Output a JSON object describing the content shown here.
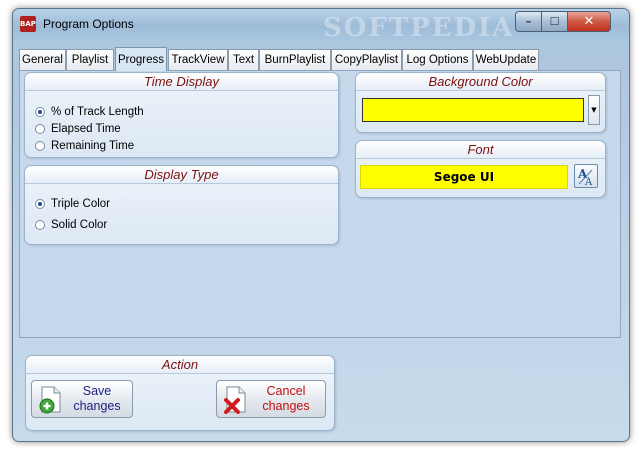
{
  "window": {
    "title": "Program Options",
    "watermark": "SOFTPEDIA",
    "icon_label": "BAP",
    "controls": {
      "minimize": "–",
      "maximize": "☐",
      "close": "✕"
    }
  },
  "tabs": [
    {
      "label": "General"
    },
    {
      "label": "Playlist"
    },
    {
      "label": "Progress"
    },
    {
      "label": "TrackView"
    },
    {
      "label": "Text"
    },
    {
      "label": "BurnPlaylist"
    },
    {
      "label": "CopyPlaylist"
    },
    {
      "label": "Log Options"
    },
    {
      "label": "WebUpdate"
    }
  ],
  "active_tab": "Progress",
  "time_display": {
    "title": "Time Display",
    "options": [
      {
        "label": "% of Track Length",
        "selected": true
      },
      {
        "label": "Elapsed Time",
        "selected": false
      },
      {
        "label": "Remaining Time",
        "selected": false
      }
    ]
  },
  "display_type": {
    "title": "Display Type",
    "options": [
      {
        "label": "Triple Color",
        "selected": true
      },
      {
        "label": "Solid Color",
        "selected": false
      }
    ]
  },
  "background_color": {
    "title": "Background Color",
    "value_color": "#ffff00"
  },
  "font": {
    "title": "Font",
    "value": "Segoe UI",
    "icon_glyph": "A"
  },
  "action": {
    "title": "Action",
    "save_label": "Save\nchanges",
    "cancel_label": "Cancel\nchanges"
  },
  "colors": {
    "accent_title": "#7a1010",
    "save_text": "#1a237e",
    "cancel_text": "#c01010",
    "yellow": "#ffff00"
  }
}
